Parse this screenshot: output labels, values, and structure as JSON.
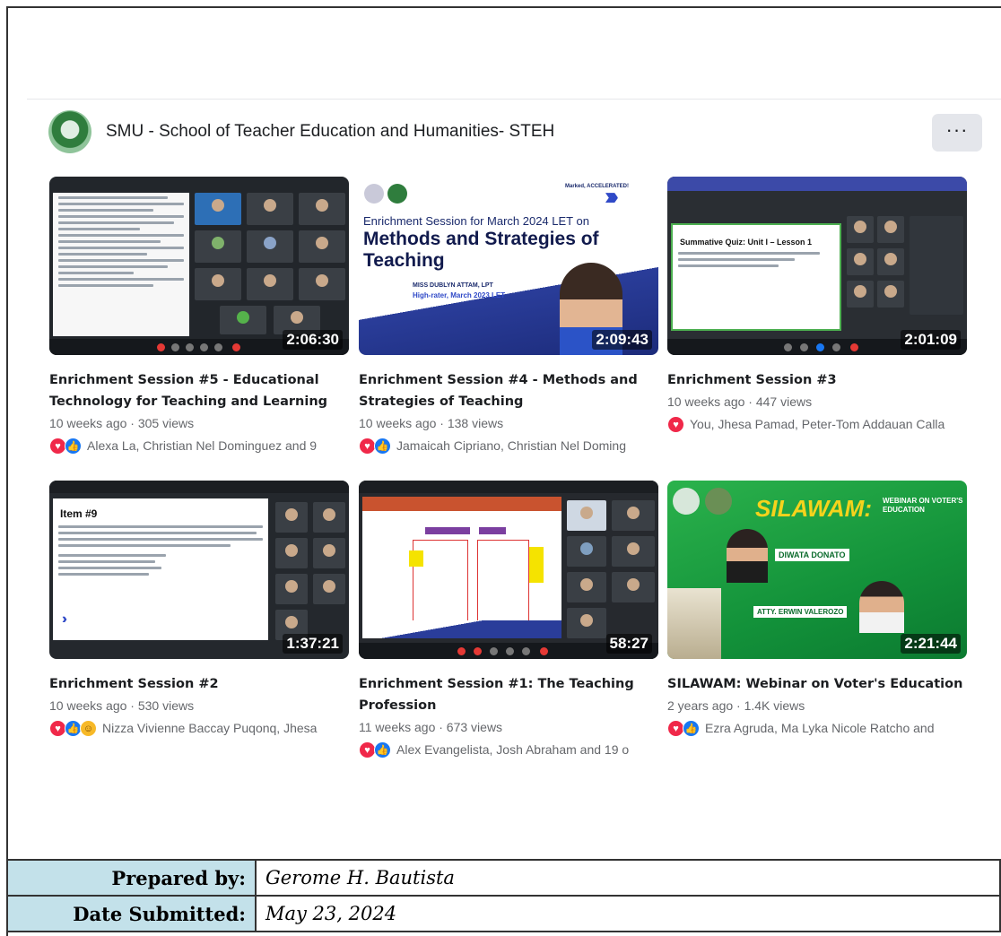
{
  "page": {
    "name": "SMU - School of Teacher Education and Humanities- STEH",
    "more_label": "···"
  },
  "videos": [
    {
      "title": "Enrichment Session #5 - Educational Technology for Teaching and Learning",
      "duration": "2:06:30",
      "meta": "10 weeks ago · 305 views",
      "reactions": [
        "love",
        "like"
      ],
      "names": "Alexa La, Christian Nel Dominguez and 9"
    },
    {
      "title": "Enrichment Session #4 - Methods and Strategies of Teaching",
      "duration": "2:09:43",
      "meta": "10 weeks ago · 138 views",
      "reactions": [
        "love",
        "like"
      ],
      "names": "Jamaicah Cipriano, Christian Nel Doming"
    },
    {
      "title": "Enrichment Session #3",
      "duration": "2:01:09",
      "meta": "10 weeks ago · 447 views",
      "reactions": [
        "love"
      ],
      "names": "You, Jhesa Pamad, Peter-Tom Addauan Calla"
    },
    {
      "title": "Enrichment Session #2",
      "duration": "1:37:21",
      "meta": "10 weeks ago · 530 views",
      "reactions": [
        "love",
        "like",
        "care"
      ],
      "names": "Nizza Vivienne Baccay Puqonq, Jhesa"
    },
    {
      "title": "Enrichment Session #1: The Teaching Profession",
      "duration": "58:27",
      "meta": "11 weeks ago · 673 views",
      "reactions": [
        "love",
        "like"
      ],
      "names": "Alex Evangelista, Josh Abraham and 19 o"
    },
    {
      "title": "SILAWAM: Webinar on Voter's Education",
      "duration": "2:21:44",
      "meta": "2 years ago · 1.4K views",
      "reactions": [
        "love",
        "like"
      ],
      "names": "Ezra Agruda, Ma Lyka Nicole Ratcho and"
    }
  ],
  "thumb_text": {
    "poster_top": "Marked, ACCELERATED!",
    "poster_line1": "Enrichment Session for March 2024 LET on",
    "poster_line2": "Methods and Strategies of",
    "poster_line3": "Teaching",
    "poster_lecturer": "MISS DUBLYN ATTAM, LPT",
    "poster_rank": "High-rater, March 2023 LET",
    "quiz_heading": "Summative Quiz: Unit I – Lesson 1",
    "item_heading": "Item #9",
    "silawam_title": "SILAWAM:",
    "silawam_sub": "WEBINAR ON VOTER'S EDUCATION",
    "speaker1": "DIWATA DONATO",
    "speaker2": "ATTY. ERWIN VALEROZO"
  },
  "footer": {
    "prepared_label": "Prepared by:",
    "prepared_value": "Gerome H. Bautista",
    "date_label": "Date Submitted:",
    "date_value": "May 23, 2024"
  },
  "colors": {
    "love": "#f02849",
    "like": "#1877f2",
    "care": "#f7b928",
    "table_label_bg": "#c3e1ea"
  }
}
